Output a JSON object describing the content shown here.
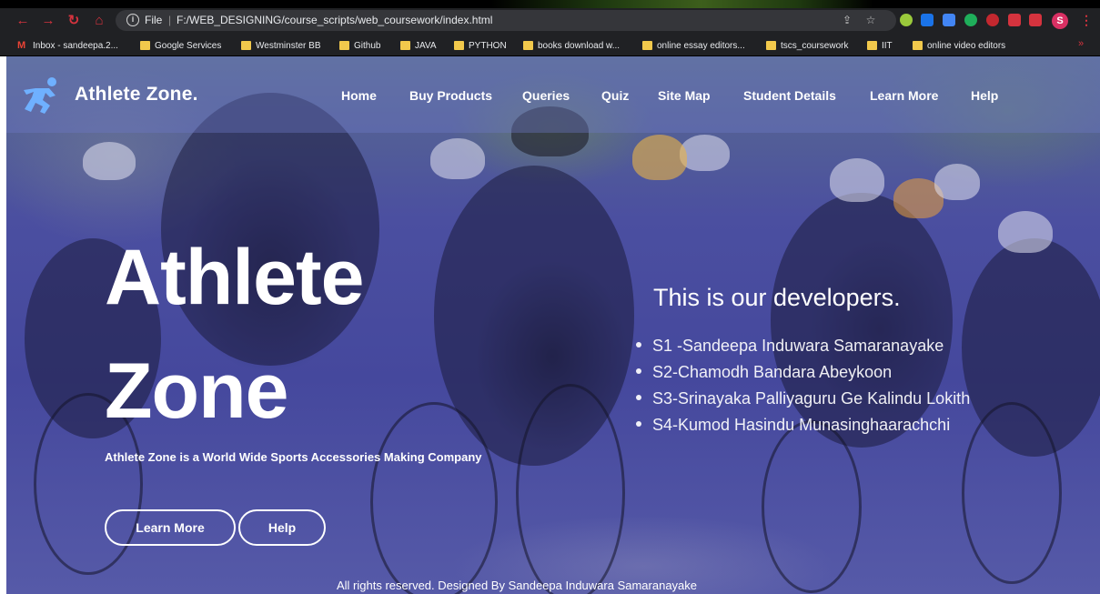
{
  "browser": {
    "scheme": "File",
    "url": "F:/WEB_DESIGNING/course_scripts/web_coursework/index.html",
    "profile_initial": "S",
    "bookmarks": [
      {
        "label": "Inbox - sandeepa.2...",
        "icon": "gmail-icon"
      },
      {
        "label": "Google Services",
        "icon": "folder-icon"
      },
      {
        "label": "Westminster BB",
        "icon": "folder-icon"
      },
      {
        "label": "Github",
        "icon": "folder-icon"
      },
      {
        "label": "JAVA",
        "icon": "folder-icon"
      },
      {
        "label": "PYTHON",
        "icon": "folder-icon"
      },
      {
        "label": "books download w...",
        "icon": "folder-icon"
      },
      {
        "label": "online essay editors...",
        "icon": "folder-icon"
      },
      {
        "label": "tscs_coursework",
        "icon": "folder-icon"
      },
      {
        "label": "IIT",
        "icon": "folder-icon"
      },
      {
        "label": "online video editors",
        "icon": "folder-icon"
      }
    ],
    "more_bookmarks": "»"
  },
  "site": {
    "brand": "Athlete Zone.",
    "nav": [
      "Home",
      "Buy Products",
      "Queries",
      "Quiz",
      "Site Map",
      "Student Details",
      "Learn More",
      "Help"
    ]
  },
  "hero": {
    "title_line1": "Athlete",
    "title_line2": "Zone",
    "description": "Athlete Zone is a World Wide Sports Accessories Making Company",
    "learn_more": "Learn More",
    "help": "Help"
  },
  "developers": {
    "title": "This is our developers.",
    "items": [
      "S1 -Sandeepa Induwara Samaranayake",
      "S2-Chamodh Bandara Abeykoon",
      "S3-Srinayaka Palliyaguru Ge Kalindu Lokith",
      "S4-Kumod Hasindu Munasinghaarachchi"
    ]
  },
  "footer": {
    "text": "All rights reserved. Designed By Sandeepa Induwara Samaranayake"
  },
  "colors": {
    "overlay": "#3a3d8a",
    "chrome": "#202124",
    "accent_red": "#d5333e",
    "folder": "#f2c94c"
  }
}
